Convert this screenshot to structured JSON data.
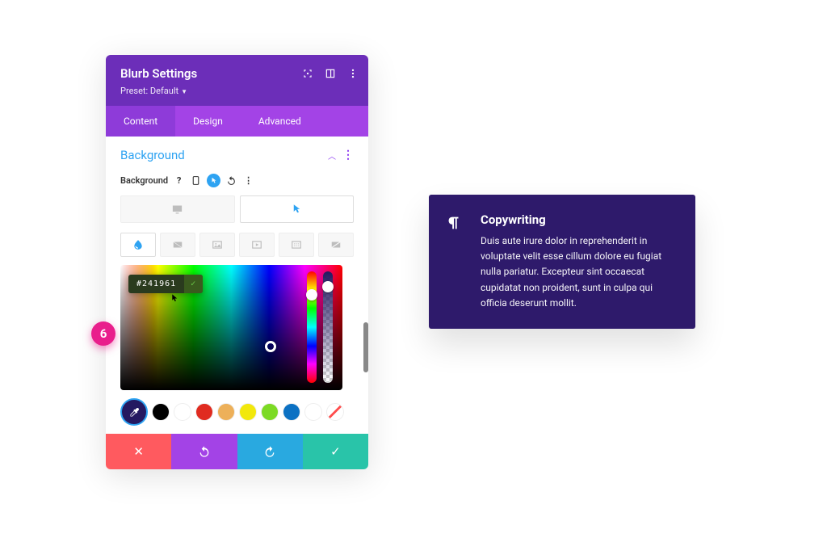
{
  "step_number": "6",
  "header": {
    "title": "Blurb Settings",
    "preset_label": "Preset: Default"
  },
  "tabs": {
    "content": "Content",
    "design": "Design",
    "advanced": "Advanced"
  },
  "section": {
    "title": "Background",
    "row_label": "Background"
  },
  "picker": {
    "hex": "#241961"
  },
  "swatches": [
    "#000000",
    "#ffffff",
    "#e02b20",
    "#edb059",
    "#ffe400",
    "#7cda24",
    "#0c71c3",
    "#ffffff"
  ],
  "preview": {
    "title": "Copywriting",
    "body": "Duis aute irure dolor in reprehenderit in voluptate velit esse cillum dolore eu fugiat nulla pariatur. Excepteur sint occaecat cupidatat non proident, sunt in culpa qui officia deserunt mollit."
  }
}
